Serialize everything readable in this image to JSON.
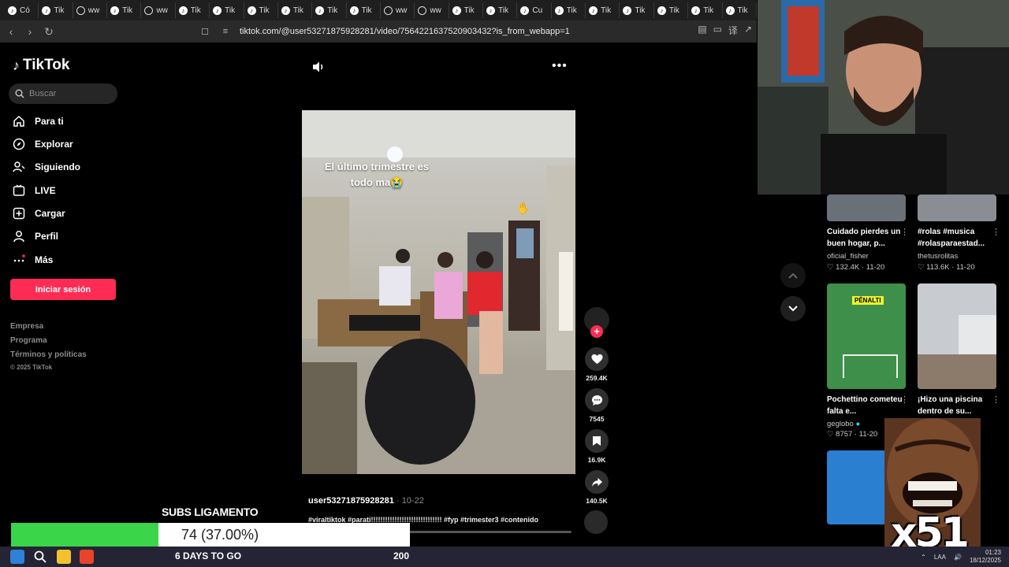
{
  "browser": {
    "tabs": [
      {
        "label": "Có",
        "icon": "tiktok-icon"
      },
      {
        "label": "Tik",
        "icon": "tiktok-icon"
      },
      {
        "label": "ww",
        "icon": "globe-icon"
      },
      {
        "label": "Tik",
        "icon": "tiktok-icon"
      },
      {
        "label": "ww",
        "icon": "globe-icon"
      },
      {
        "label": "Tik",
        "icon": "tiktok-icon"
      },
      {
        "label": "Tik",
        "icon": "tiktok-icon"
      },
      {
        "label": "Tik",
        "icon": "tiktok-icon"
      },
      {
        "label": "Tik",
        "icon": "tiktok-icon"
      },
      {
        "label": "Tik",
        "icon": "tiktok-icon"
      },
      {
        "label": "Tik",
        "icon": "tiktok-icon"
      },
      {
        "label": "ww",
        "icon": "globe-icon"
      },
      {
        "label": "ww",
        "icon": "globe-icon"
      },
      {
        "label": "Tik",
        "icon": "tiktok-icon"
      },
      {
        "label": "Tik",
        "icon": "tiktok-icon"
      },
      {
        "label": "Cu",
        "icon": "tiktok-icon"
      },
      {
        "label": "Tik",
        "icon": "tiktok-icon"
      },
      {
        "label": "Tik",
        "icon": "tiktok-icon"
      },
      {
        "label": "Tik",
        "icon": "tiktok-icon"
      },
      {
        "label": "Tik",
        "icon": "tiktok-icon"
      },
      {
        "label": "Tik",
        "icon": "tiktok-icon"
      },
      {
        "label": "Tik",
        "icon": "tiktok-icon"
      }
    ],
    "url": "tiktok.com/@user53271875928281/video/7564221637520903432?is_from_webapp=1"
  },
  "sidebar": {
    "brand": "TikTok",
    "search_placeholder": "Buscar",
    "nav": [
      {
        "label": "Para ti",
        "icon": "home-icon"
      },
      {
        "label": "Explorar",
        "icon": "compass-icon"
      },
      {
        "label": "Siguiendo",
        "icon": "following-icon"
      },
      {
        "label": "LIVE",
        "icon": "live-icon"
      },
      {
        "label": "Cargar",
        "icon": "upload-icon"
      },
      {
        "label": "Perfil",
        "icon": "profile-icon"
      },
      {
        "label": "Más",
        "icon": "more-dots-icon"
      }
    ],
    "login_label": "Iniciar sesión",
    "footer": [
      "Empresa",
      "Programa",
      "Términos y políticas"
    ],
    "copyright": "© 2025 TikTok"
  },
  "video": {
    "overlay_line1": "El último trimestre es",
    "overlay_line2": "todo ma😭",
    "author": "user53271875928281",
    "date": "10-22",
    "caption": "#viraltiktok #parati!!!!!!!!!!!!!!!!!!!!!!!!!!!!!! #fyp #trimester3 #contenido",
    "likes": "259.4K",
    "comments": "7545",
    "saves": "16.9K",
    "shares": "140.5K"
  },
  "recommendations": [
    {
      "title": "Cuidado pierdes un buen hogar, p...",
      "user": "oficial_fisher",
      "likes": "132.4K",
      "date": "11-20"
    },
    {
      "title": "#rolas #musica #rolasparaestad...",
      "user": "thetusrolitas",
      "likes": "113.6K",
      "date": "11-20"
    },
    {
      "title": "Pochettino cometeu falta e...",
      "user": "geglobo",
      "likes": "8757",
      "date": "11-20",
      "badge": "PÊNALTI"
    },
    {
      "title": "¡Hizo una piscina dentro de su...",
      "user": "",
      "likes": "",
      "date": ""
    }
  ],
  "overlay": {
    "subs_title": "SUBS LIGAMENTO",
    "subs_value": "74 (37.00%)",
    "subs_fraction": 0.37,
    "days_to_go": "6 DAYS TO GO",
    "goal": "200",
    "meme_text": "x51"
  },
  "taskbar": {
    "lang": "LAA",
    "time": "01:23",
    "date": "18/12/2025"
  },
  "colors": {
    "accent": "#fe2c55",
    "progress_green": "#3bd54a"
  }
}
